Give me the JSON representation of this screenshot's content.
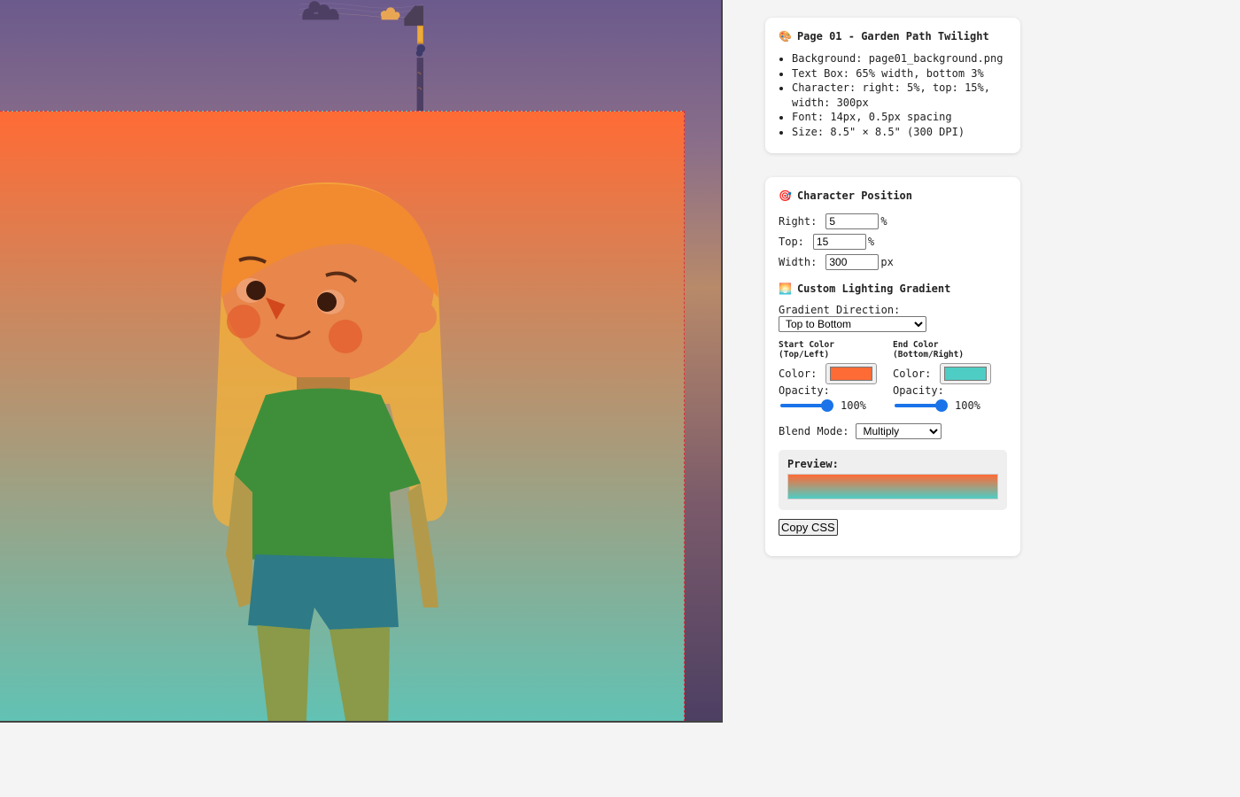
{
  "canvas": {
    "background_image": "page01_background.png",
    "gradient_start": "#ff6b35",
    "gradient_end": "#4ecdc4"
  },
  "info_panel": {
    "icon": "palette-icon",
    "title": "Page 01 - Garden Path Twilight",
    "items": [
      "Background: page01_background.png",
      "Text Box: 65% width, bottom 3%",
      "Character: right: 5%, top: 15%, width: 300px",
      "Font: 14px, 0.5px spacing",
      "Size: 8.5\" × 8.5\" (300 DPI)"
    ]
  },
  "character_position": {
    "icon": "target-icon",
    "title": "Character Position",
    "right_label": "Right:",
    "right_value": "5",
    "right_unit": "%",
    "top_label": "Top:",
    "top_value": "15",
    "top_unit": "%",
    "width_label": "Width:",
    "width_value": "300",
    "width_unit": "px"
  },
  "gradient": {
    "icon": "sunset-icon",
    "title": "Custom Lighting Gradient",
    "direction_label": "Gradient Direction:",
    "direction_value": "Top to Bottom",
    "start_heading_1": "Start Color",
    "start_heading_2": "(Top/Left)",
    "end_heading_1": "End Color",
    "end_heading_2": "(Bottom/Right)",
    "color_label": "Color:",
    "opacity_label": "Opacity:",
    "start_color": "#ff6b35",
    "end_color": "#4ecdc4",
    "start_opacity": "100%",
    "end_opacity": "100%",
    "blend_label": "Blend Mode:",
    "blend_value": "Multiply",
    "preview_label": "Preview:",
    "copy_button": "Copy CSS"
  }
}
